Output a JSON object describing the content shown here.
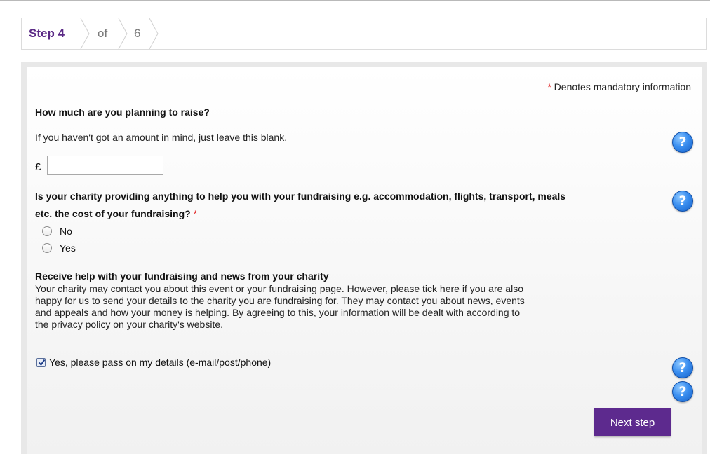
{
  "steps": {
    "current": "Step 4",
    "of": "of",
    "total": "6"
  },
  "form": {
    "mandatory_note": "Denotes mandatory information",
    "required_marker": "*",
    "raise": {
      "title": "How much are you planning to raise?",
      "hint": "If you haven't got an amount in mind, just leave this blank.",
      "currency": "£",
      "value": ""
    },
    "charity_help": {
      "title_line1": "Is your charity providing anything to help you with your fundraising e.g. accommodation, flights, transport, meals",
      "title_line2": "etc. the cost of your fundraising?",
      "options": [
        "No",
        "Yes"
      ]
    },
    "news": {
      "title": "Receive help with your fundraising and news from your charity",
      "lines": [
        "Your charity may contact you about this event or your fundraising page. However, please tick here if you are also",
        "happy for us to send your details to the charity you are fundraising for. They may contact you about news, events",
        "and appeals and how your money is helping. By agreeing to this, your information will be dealt with according to",
        "the privacy policy on your charity's website."
      ],
      "checkbox_label": "Yes, please pass on my details (e-mail/post/phone)",
      "checked": true
    },
    "next_button": "Next step",
    "help_icon_glyph": "?"
  },
  "colors": {
    "brand_purple": "#5d2a8e",
    "help_blue": "#3b8ff0",
    "required_red": "#e02020"
  }
}
